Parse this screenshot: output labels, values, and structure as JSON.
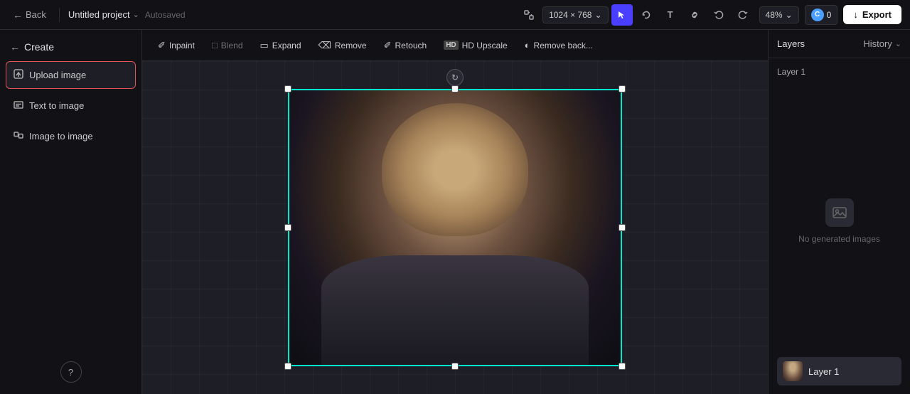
{
  "header": {
    "back_label": "Back",
    "project_name": "Untitled project",
    "autosaved_label": "Autosaved",
    "canvas_size": "1024 × 768",
    "zoom_level": "48%",
    "credits_count": "0",
    "export_label": "Export"
  },
  "toolbar": {
    "inpaint_label": "Inpaint",
    "blend_label": "Blend",
    "expand_label": "Expand",
    "remove_label": "Remove",
    "retouch_label": "Retouch",
    "upscale_label": "HD Upscale",
    "remove_bg_label": "Remove back..."
  },
  "sidebar": {
    "create_label": "Create",
    "items": [
      {
        "id": "upload-image",
        "label": "Upload image",
        "active": true
      },
      {
        "id": "text-to-image",
        "label": "Text to image",
        "active": false
      },
      {
        "id": "image-to-image",
        "label": "Image to image",
        "active": false
      }
    ]
  },
  "right_panel": {
    "layers_tab": "Layers",
    "history_tab": "History",
    "layer_label": "Layer 1",
    "no_generated_label": "No generated images",
    "layer_item_name": "Layer 1"
  }
}
